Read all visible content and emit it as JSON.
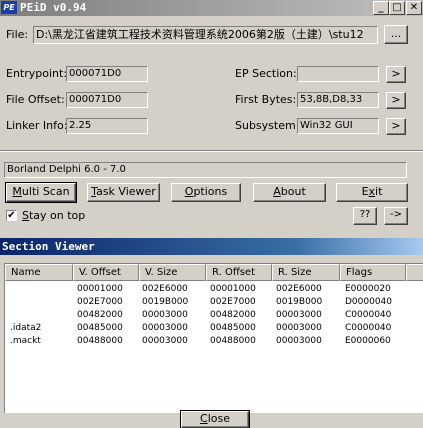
{
  "peid": {
    "title": "PEiD v0.94",
    "app_icon_text": "PE",
    "file_label": "File:",
    "file_path": "D:\\黑龙江省建筑工程技术资料管理系统2006第2版（土建）\\stu12",
    "browse_label": "...",
    "entrypoint_label": "Entrypoint:",
    "entrypoint_value": "000071D0",
    "file_offset_label": "File Offset:",
    "file_offset_value": "000071D0",
    "linker_label": "Linker Info:",
    "linker_value": "2.25",
    "ep_section_label": "EP Section:",
    "ep_section_value": "",
    "first_bytes_label": "First Bytes:",
    "first_bytes_value": "53,8B,D8,33",
    "subsystem_label": "Subsystem:",
    "subsystem_value": "Win32 GUI",
    "arrow_label": ">",
    "detection": "Borland Delphi 6.0 - 7.0",
    "buttons": {
      "multi_scan": {
        "ul": "M",
        "rest": "ulti Scan"
      },
      "task_viewer": {
        "ul": "T",
        "rest": "ask Viewer"
      },
      "options": {
        "ul": "O",
        "rest": "ptions"
      },
      "about": {
        "ul": "A",
        "rest": "bout"
      },
      "exit": {
        "pre": "E",
        "ul": "x",
        "rest": "it"
      }
    },
    "stay_on_top": {
      "ul": "S",
      "rest": "tay on top",
      "checked": true,
      "mark": "✔"
    },
    "help_label": "??",
    "ext_label": "->"
  },
  "section_viewer": {
    "title": "Section Viewer",
    "columns": [
      "Name",
      "V. Offset",
      "V. Size",
      "R. Offset",
      "R. Size",
      "Flags"
    ],
    "rows": [
      [
        "",
        "00001000",
        "002E6000",
        "00001000",
        "002E6000",
        "E0000020"
      ],
      [
        "",
        "002E7000",
        "0019B000",
        "002E7000",
        "0019B000",
        "D0000040"
      ],
      [
        "",
        "00482000",
        "00003000",
        "00482000",
        "00003000",
        "C0000040"
      ],
      [
        ".idata2",
        "00485000",
        "00003000",
        "00485000",
        "00003000",
        "C0000040"
      ],
      [
        ".mackt",
        "00488000",
        "00003000",
        "00488000",
        "00003000",
        "E0000060"
      ]
    ],
    "close": {
      "ul": "C",
      "rest": "lose"
    }
  }
}
